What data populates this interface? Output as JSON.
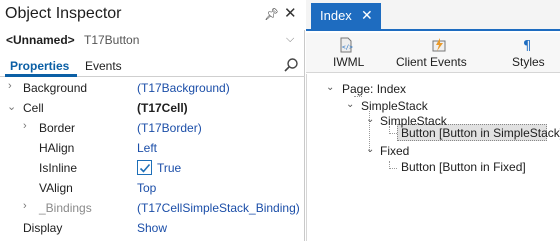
{
  "inspector": {
    "title": "Object Inspector",
    "selected_name": "<Unnamed>",
    "selected_class": "T17Button",
    "tabs": [
      "Properties",
      "Events"
    ],
    "props": {
      "background": {
        "key": "Background",
        "value": "(T17Background)"
      },
      "cell": {
        "key": "Cell",
        "value": "(T17Cell)"
      },
      "border": {
        "key": "Border",
        "value": "(T17Border)"
      },
      "halign": {
        "key": "HAlign",
        "value": "Left"
      },
      "isinline": {
        "key": "IsInline",
        "value": "True",
        "checked": true
      },
      "valign": {
        "key": "VAlign",
        "value": "Top"
      },
      "bindings": {
        "key": "_Bindings",
        "value": "(T17CellSimpleStack_Binding)"
      },
      "display": {
        "key": "Display",
        "value": "Show"
      }
    }
  },
  "index": {
    "tab": "Index",
    "toolbar": [
      "IWML",
      "Client Events",
      "Styles"
    ],
    "tree": {
      "page": "Page: Index",
      "stack1": "SimpleStack",
      "stack2": "SimpleStack",
      "btn1": "Button [Button in SimpleStack]",
      "fixed": "Fixed",
      "btn2": "Button [Button in Fixed]"
    }
  },
  "colors": {
    "accent": "#1e6cc0",
    "value_link": "#1b4ea8"
  }
}
